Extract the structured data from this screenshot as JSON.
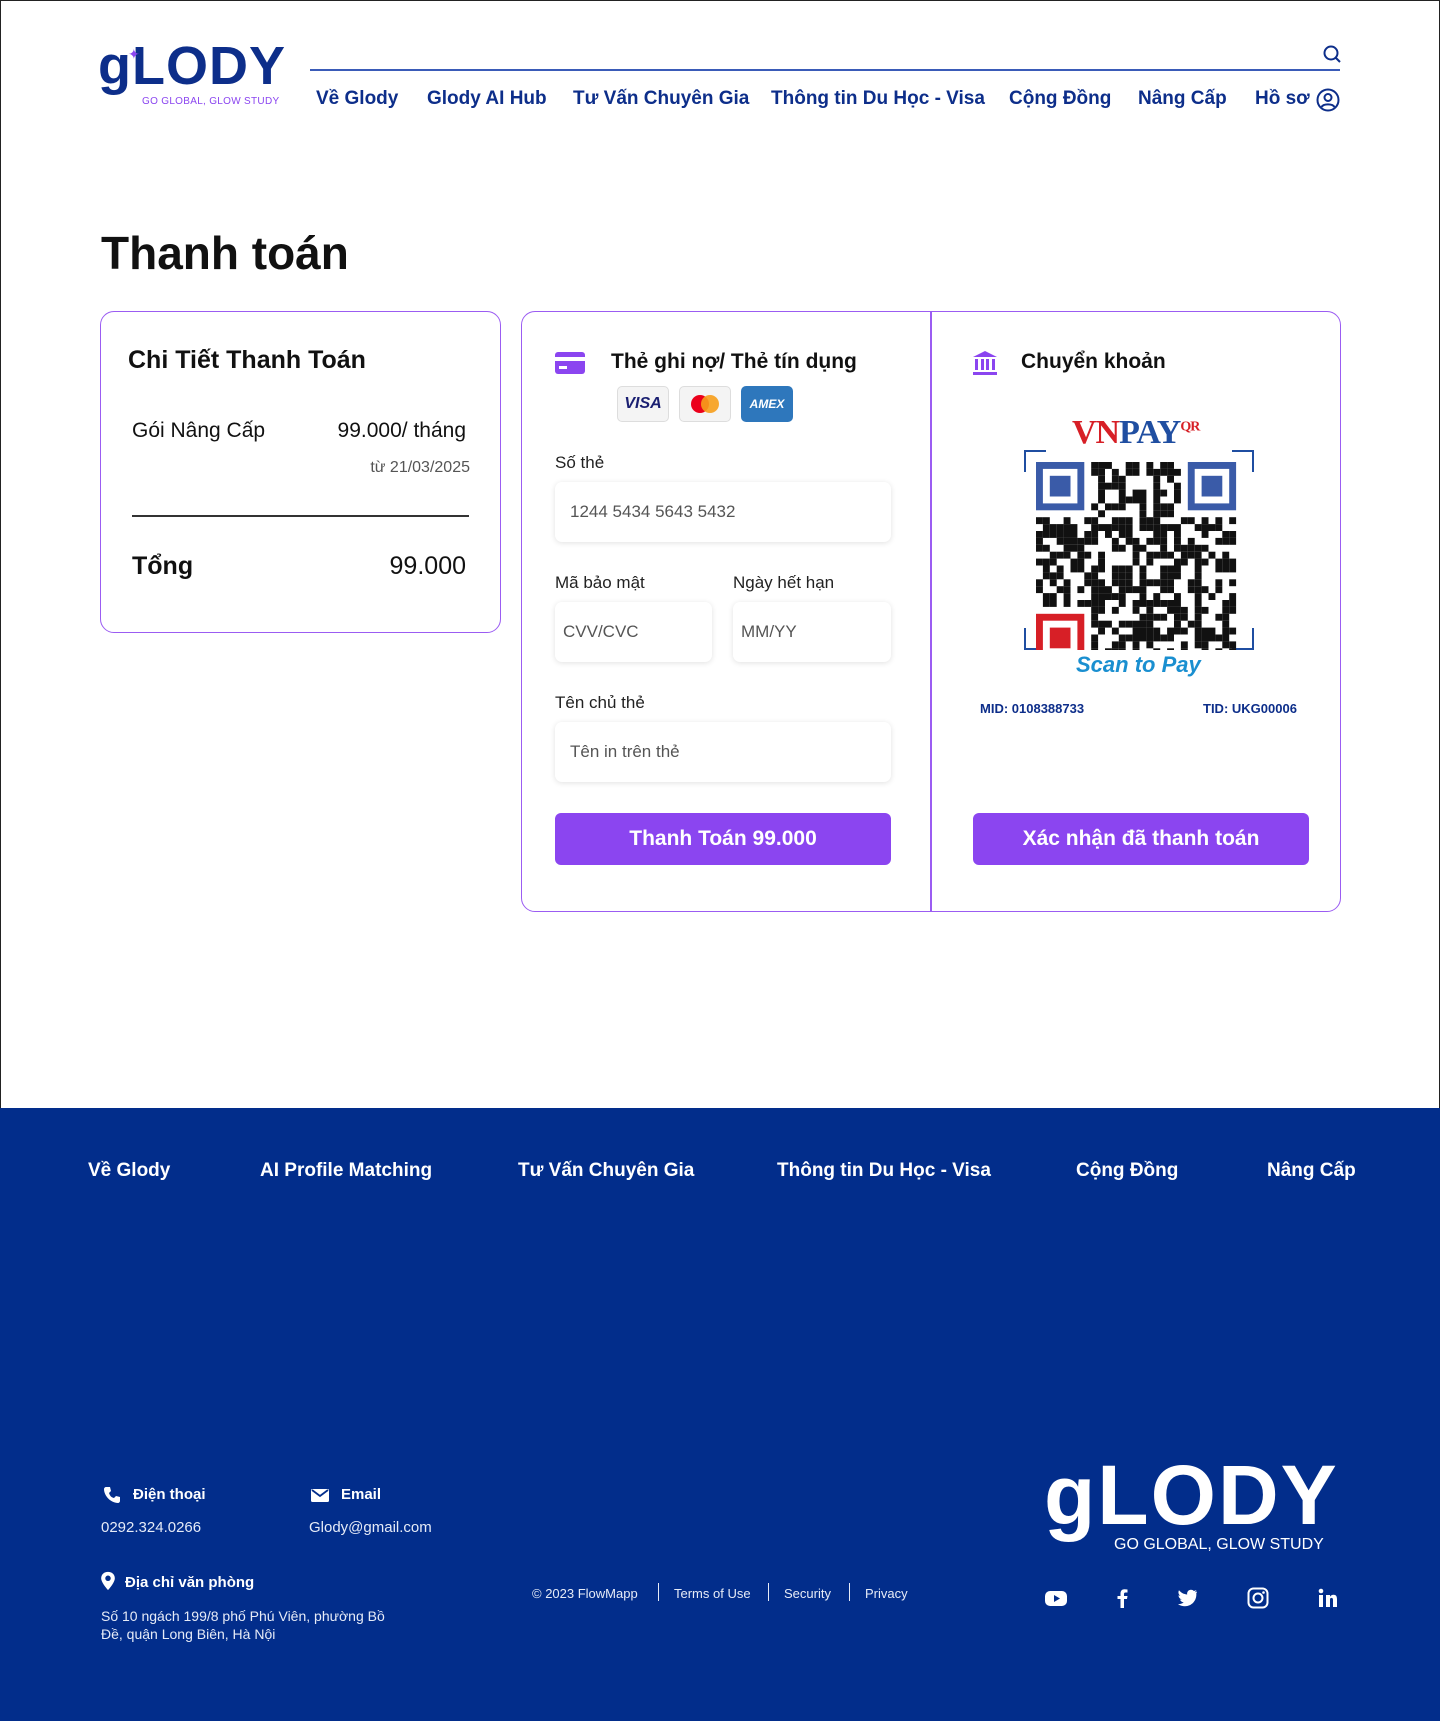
{
  "header": {
    "logo_text": "gLODY",
    "logo_tagline": "GO GLOBAL, GLOW STUDY",
    "nav": [
      "Về Glody",
      "Glody AI Hub",
      "Tư Vấn Chuyên Gia",
      "Thông tin Du Học - Visa",
      "Cộng Đồng",
      "Nâng Cấp",
      "Hồ sơ"
    ]
  },
  "page": {
    "title": "Thanh toán"
  },
  "summary": {
    "title": "Chi Tiết Thanh Toán",
    "item_label": "Gói Nâng Cấp",
    "item_price": "99.000/ tháng",
    "since": "từ 21/03/2025",
    "total_label": "Tổng",
    "total_value": "99.000"
  },
  "card": {
    "title": "Thẻ ghi nợ/ Thẻ tín dụng",
    "brands": [
      "VISA",
      "mastercard",
      "AMEX"
    ],
    "number_label": "Số thẻ",
    "number_placeholder": "1244 5434 5643 5432",
    "cvv_label": "Mã bảo mật",
    "cvv_placeholder": "CVV/CVC",
    "expiry_label": "Ngày hết hạn",
    "expiry_placeholder": "MM/YY",
    "holder_label": "Tên chủ thẻ",
    "holder_placeholder": "Tên in trên thẻ",
    "pay_button": "Thanh Toán 99.000"
  },
  "transfer": {
    "title": "Chuyển khoản",
    "qr_brand_vn": "VN",
    "qr_brand_pay": "PAY",
    "qr_brand_sup": "QR",
    "scan_text": "Scan to Pay",
    "mid": "MID: 0108388733",
    "tid": "TID: UKG00006",
    "confirm_button": "Xác nhận đã thanh toán"
  },
  "footer": {
    "nav": [
      "Về Glody",
      "AI Profile Matching",
      "Tư Vấn Chuyên Gia",
      "Thông tin Du Học - Visa",
      "Cộng Đồng",
      "Nâng Cấp"
    ],
    "phone_label": "Điện thoại",
    "phone_value": "0292.324.0266",
    "email_label": "Email",
    "email_value": "Glody@gmail.com",
    "address_label": "Địa chỉ văn phòng",
    "address_line1": "Số 10 ngách 199/8 phố Phú Viên, phường Bồ",
    "address_line2": "Đề, quận Long Biên, Hà Nội",
    "logo_text": "gLODY",
    "logo_tagline": "GO GLOBAL, GLOW STUDY",
    "copyright": "© 2023 FlowMapp",
    "terms": "Terms of Use",
    "security": "Security",
    "privacy": "Privacy",
    "social_icons": [
      "youtube-icon",
      "facebook-icon",
      "twitter-icon",
      "instagram-icon",
      "linkedin-icon"
    ]
  },
  "colors": {
    "brand_blue": "#0d2e8a",
    "accent_purple": "#8b45f0",
    "footer_bg": "#022d8b"
  }
}
